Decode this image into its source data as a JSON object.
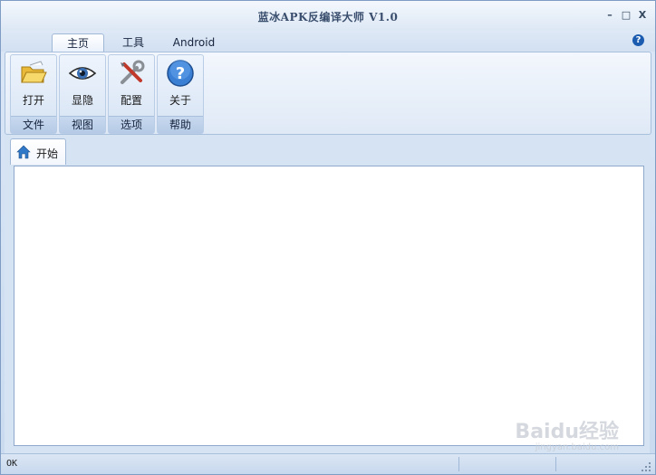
{
  "window": {
    "title": "蓝冰APK反编译大师 V1.0",
    "minimize_glyph": "–",
    "maximize_glyph": "□",
    "close_glyph": "X"
  },
  "ribbon_tabs": [
    {
      "label": "主页",
      "active": true
    },
    {
      "label": "工具",
      "active": false
    },
    {
      "label": "Android",
      "active": false
    }
  ],
  "help_glyph": "?",
  "groups": [
    {
      "button_label": "打开",
      "group_label": "文件",
      "icon": "open-folder-icon"
    },
    {
      "button_label": "显隐",
      "group_label": "视图",
      "icon": "eye-icon"
    },
    {
      "button_label": "配置",
      "group_label": "选项",
      "icon": "tools-icon"
    },
    {
      "button_label": "关于",
      "group_label": "帮助",
      "icon": "help-icon"
    }
  ],
  "document_tab": {
    "label": "开始",
    "icon": "home-icon"
  },
  "status": {
    "text": "OK"
  },
  "watermark": {
    "text": "Baidu经验",
    "sub": "jingyan.baidu.com"
  },
  "colors": {
    "accent": "#1b5cb0",
    "frame": "#7f9dc4",
    "content_bg": "#ffffff"
  }
}
